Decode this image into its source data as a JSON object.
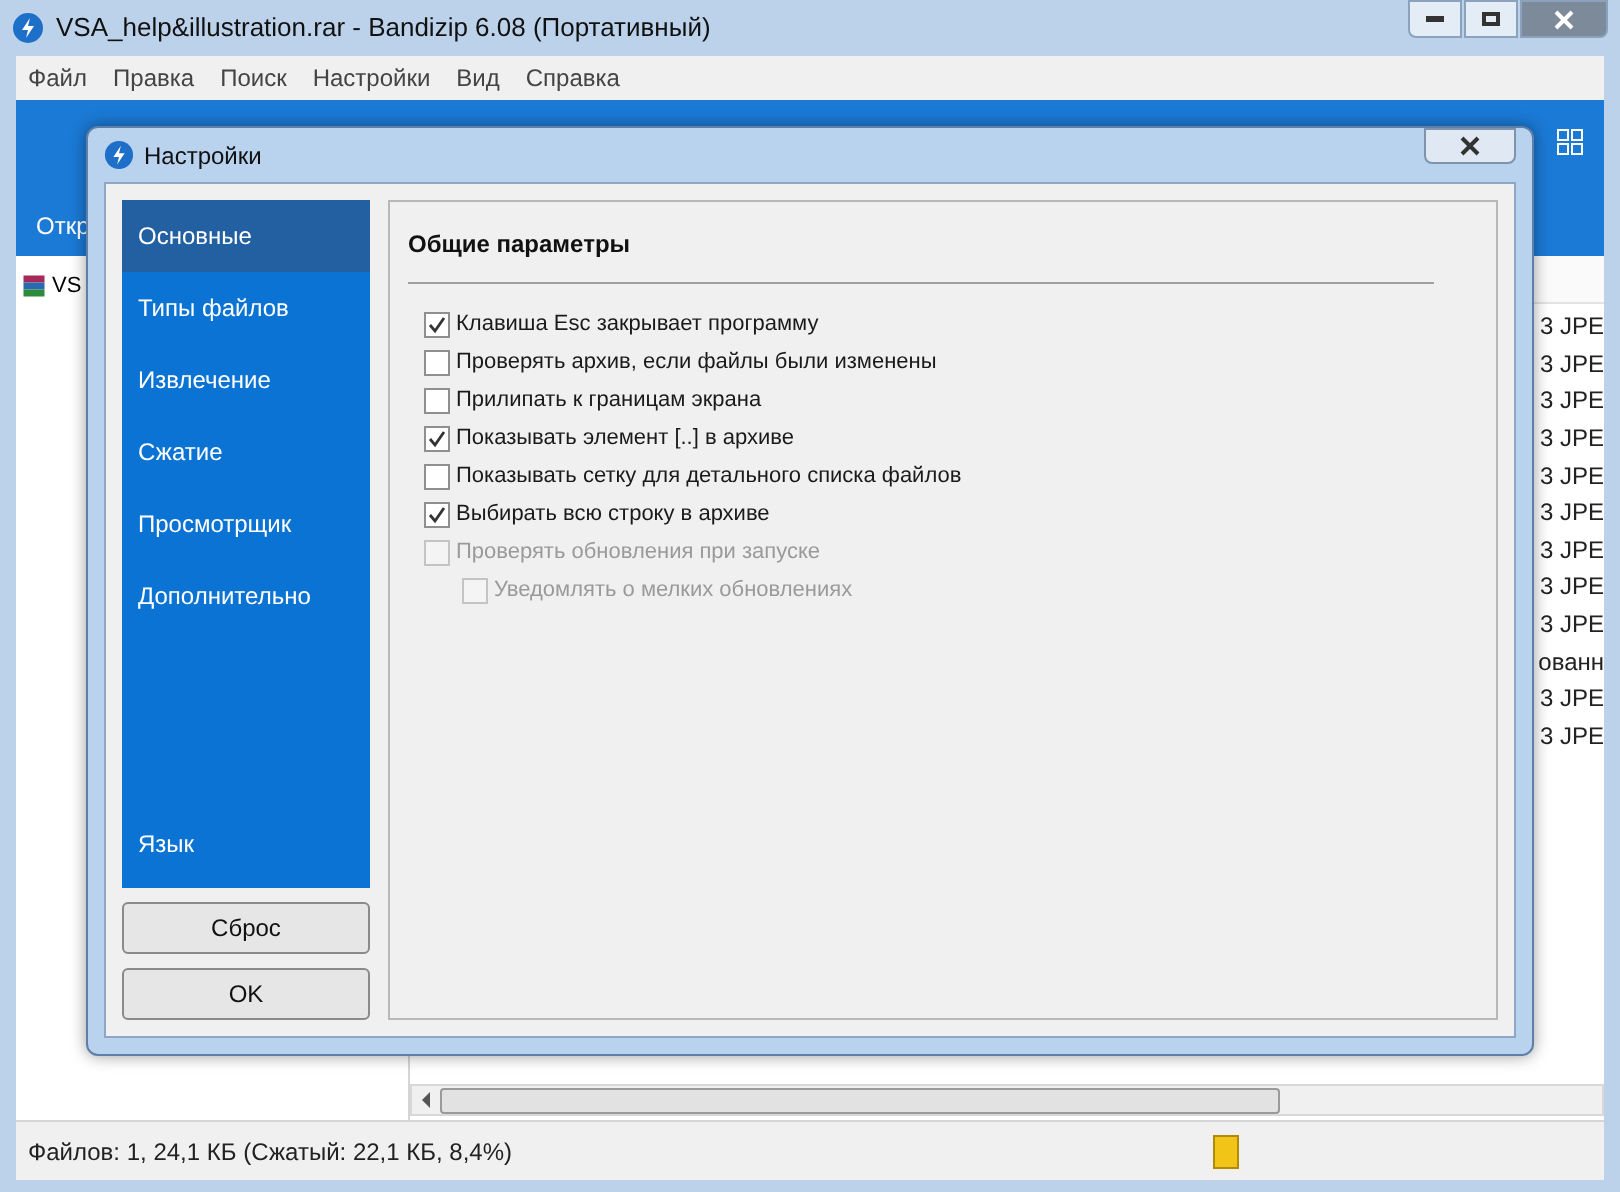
{
  "main_window": {
    "title": "VSA_help&illustration.rar - Bandizip 6.08 (Портативный)",
    "menu": [
      "Файл",
      "Правка",
      "Поиск",
      "Настройки",
      "Вид",
      "Справка"
    ],
    "toolbar_label": "Откр",
    "tree_item": "VS",
    "list_cells": [
      "3 JPE",
      "3 JPE",
      "3 JPE",
      "3 JPE",
      "3 JPE",
      "3 JPE",
      "3 JPE",
      "3 JPE",
      "3 JPE",
      "ованн",
      "3 JPE",
      "3 JPE"
    ],
    "status": "Файлов: 1, 24,1 КБ (Сжатый: 22,1 КБ, 8,4%)"
  },
  "dialog": {
    "title": "Настройки",
    "nav": [
      {
        "label": "Основные",
        "selected": true
      },
      {
        "label": "Типы файлов",
        "selected": false
      },
      {
        "label": "Извлечение",
        "selected": false
      },
      {
        "label": "Сжатие",
        "selected": false
      },
      {
        "label": "Просмотрщик",
        "selected": false
      },
      {
        "label": "Дополнительно",
        "selected": false
      }
    ],
    "nav_bottom": {
      "label": "Язык",
      "selected": false
    },
    "buttons": [
      "Сброс",
      "OK"
    ],
    "section_title": "Общие параметры",
    "options": [
      {
        "label": "Клавиша Esc закрывает программу",
        "checked": true,
        "disabled": false
      },
      {
        "label": "Проверять архив, если файлы были изменены",
        "checked": false,
        "disabled": false
      },
      {
        "label": "Прилипать к границам экрана",
        "checked": false,
        "disabled": false
      },
      {
        "label": "Показывать элемент [..] в архиве",
        "checked": true,
        "disabled": false
      },
      {
        "label": "Показывать сетку для детального списка файлов",
        "checked": false,
        "disabled": false
      },
      {
        "label": "Выбирать всю строку в архиве",
        "checked": true,
        "disabled": false
      },
      {
        "label": "Проверять обновления при запуске",
        "checked": false,
        "disabled": true,
        "children": [
          {
            "label": "Уведомлять о мелких обновлениях",
            "checked": false,
            "disabled": true
          }
        ]
      }
    ]
  }
}
